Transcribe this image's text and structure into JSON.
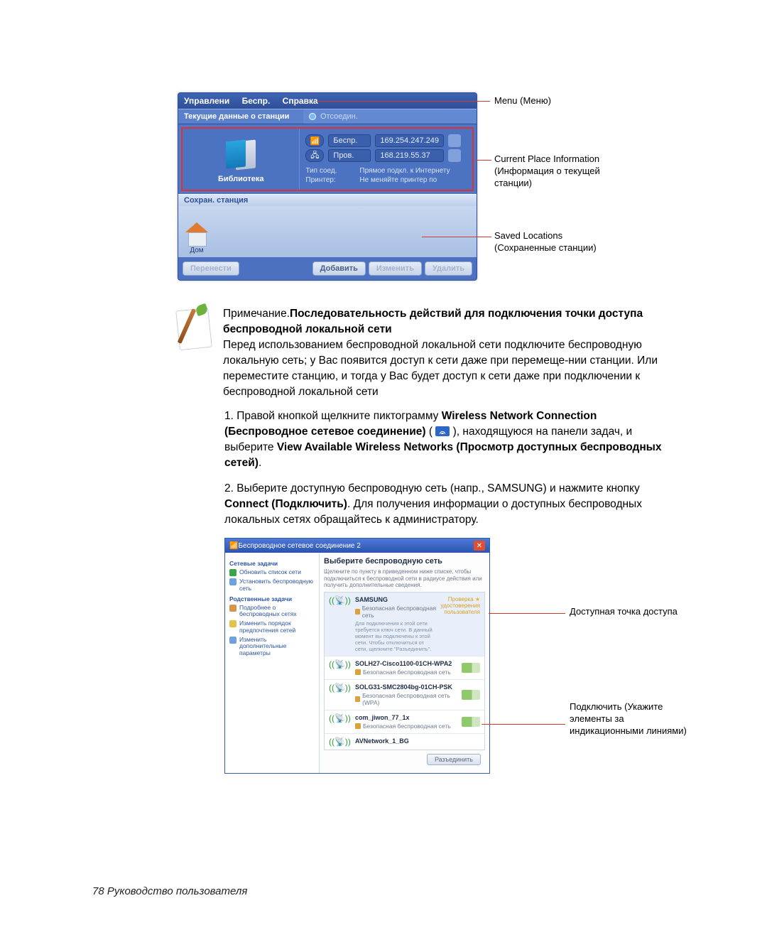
{
  "callouts": {
    "menu": "Menu (Меню)",
    "current_place": "Current Place Information (Информация о текущей станции)",
    "saved": "Saved Locations (Сохраненные станции)",
    "available_ap": "Доступная точка доступа",
    "connect_hint": "Подключить (Укажите элементы за индикационными линиями)"
  },
  "app_window": {
    "menus": {
      "manage": "Управлени",
      "wireless": "Беспр.",
      "help": "Справка"
    },
    "status_left": "Текущие данные о станции",
    "status_right": "Отсоедин.",
    "library_label": "Библиотека",
    "rows": {
      "wireless": {
        "label": "Беспр.",
        "ip": "169.254.247.249"
      },
      "wired": {
        "label": "Пров.",
        "ip": "168.219.55.37"
      }
    },
    "conn_type_label": "Тип соед.",
    "conn_type_value": "Прямое подкл. к Интернету",
    "printer_label": "Принтер:",
    "printer_value": "Не меняйте принтер по",
    "saved_header": "Сохран. станция",
    "saved_item": "Дом",
    "buttons": {
      "move": "Перенести",
      "add": "Добавить",
      "edit": "Изменить",
      "delete": "Удалить"
    }
  },
  "note": {
    "title_prefix": "Примечание.",
    "title_bold": "Последовательность действий для подключения точки доступа беспроводной локальной сети",
    "para": "Перед использованием беспроводной локальной сети подключите беспроводную локальную сеть; у Вас появится доступ к сети даже при перемеще-нии станции. Или переместите станцию, и тогда у Вас будет доступ к сети даже при подключении к беспроводной локальной сети"
  },
  "steps": {
    "s1a": "1. Правой кнопкой щелкните пиктограмму ",
    "s1b": "Wireless Network Connection (Беспроводное сетевое соединение)",
    "s1c": " ( ",
    "s1d": " ), находящуюся на панели задач, и выберите ",
    "s1e": "View Available Wireless Networks (Просмотр доступных беспроводных сетей)",
    "s1f": ".",
    "s2a": "2. Выберите доступную беспроводную сеть (напр., SAMSUNG) и нажмите кнопку ",
    "s2b": "Connect (Подключить)",
    "s2c": ". Для получения информации о доступных беспроводных локальных сетях обращайтесь к администратору."
  },
  "xp": {
    "title": "Беспроводное сетевое соединение 2",
    "side": {
      "g1": "Сетевые задачи",
      "i1": "Обновить список сети",
      "i2": "Установить беспроводную сеть",
      "g2": "Родственные задачи",
      "i3": "Подробнее о беспроводных сетях",
      "i4": "Изменить порядок предпочтения сетей",
      "i5": "Изменить дополнительные параметры"
    },
    "main_heading": "Выберите беспроводную сеть",
    "main_desc": "Щелкните по пункту в приведенном ниже списке, чтобы подключиться к беспроводной сети в радиусе действия или получить дополнительные сведения.",
    "networks": [
      {
        "name": "SAMSUNG",
        "sub": "Безопасная беспроводная сеть",
        "badge1": "Проверка",
        "badge2": "удостоверения",
        "badge3": "пользователя",
        "extra": "Для подключения к этой сети требуется ключ сети. В данный момент вы подключены к этой сети. Чтобы отключиться от сети, щелкните \"Разъединить\"."
      },
      {
        "name": "SOLH27-Cisco1100-01CH-WPA2",
        "sub": "Безопасная беспроводная сеть"
      },
      {
        "name": "SOLG31-SMC2804bg-01CH-PSK",
        "sub": "Безопасная беспроводная сеть (WPA)"
      },
      {
        "name": "com_jiwon_77_1x",
        "sub": "Безопасная беспроводная сеть"
      },
      {
        "name": "AVNetwork_1_BG",
        "sub": ""
      }
    ],
    "connect_btn": "Разъединить"
  },
  "footer": "78  Руководство пользователя"
}
